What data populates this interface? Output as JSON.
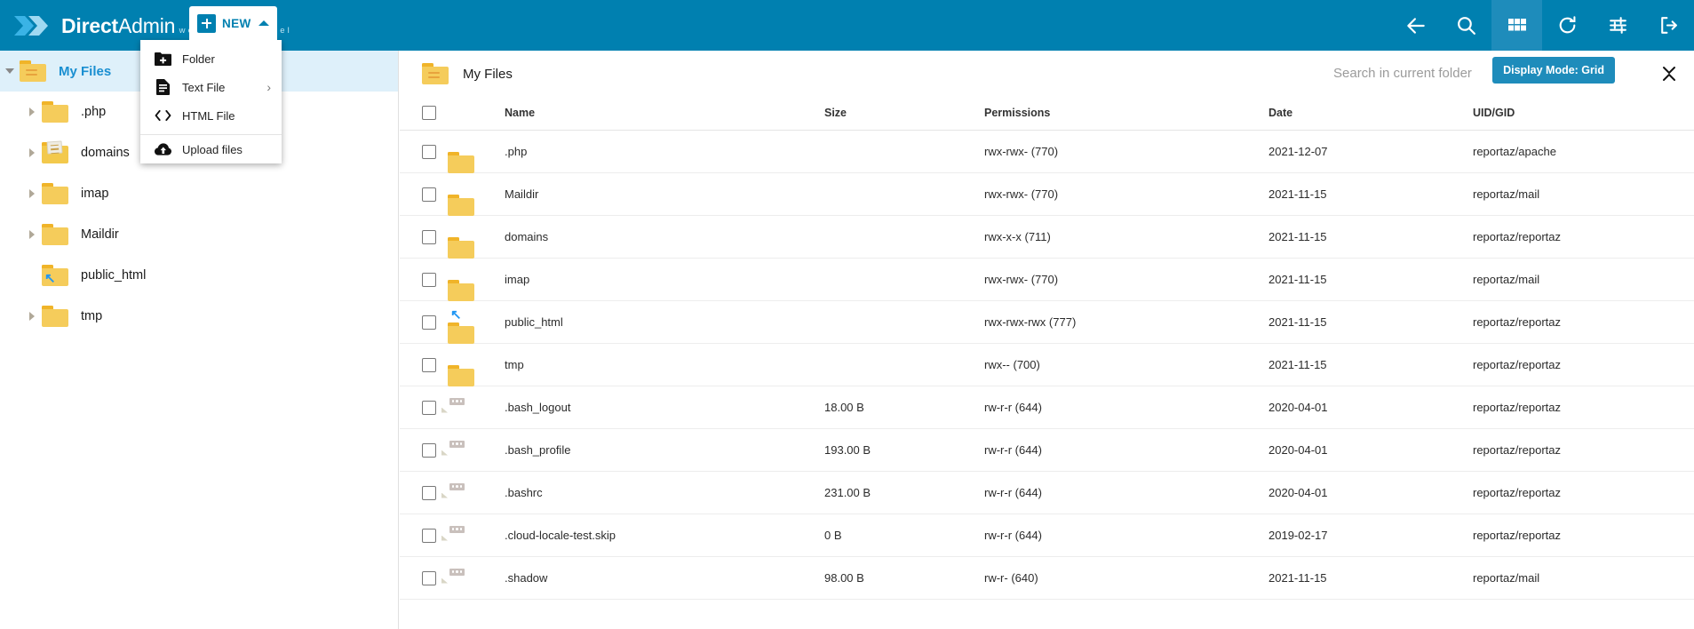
{
  "brand": {
    "title_bold": "Direct",
    "title_thin": "Admin",
    "subtitle": "web control panel",
    "accent": "#0080b0",
    "accent_active": "#1e8cbb"
  },
  "topbar": {
    "new_button": {
      "label": "NEW",
      "icon": "plus-icon",
      "caret": "chevron-up-icon"
    },
    "dropdown": {
      "items": [
        {
          "label": "Folder",
          "icon": "folder-plus-icon",
          "has_submenu": false
        },
        {
          "label": "Text File",
          "icon": "text-file-icon",
          "has_submenu": true,
          "arrow": "›"
        },
        {
          "label": "HTML File",
          "icon": "code-brackets-icon",
          "has_submenu": false
        },
        {
          "label": "Upload files",
          "icon": "cloud-upload-icon",
          "has_submenu": false,
          "separated": true
        }
      ]
    },
    "tools": [
      {
        "name": "back-arrow-icon",
        "active": false
      },
      {
        "name": "search-icon",
        "active": false
      },
      {
        "name": "grid-view-icon",
        "active": true
      },
      {
        "name": "refresh-icon",
        "active": false
      },
      {
        "name": "settings-sliders-icon",
        "active": false
      },
      {
        "name": "logout-icon",
        "active": false
      }
    ]
  },
  "sidebar": {
    "tree": [
      {
        "label": "My Files",
        "icon": "folder-lines-icon",
        "expanded": true,
        "selected": true,
        "level": 0
      },
      {
        "label": ".php",
        "icon": "folder-icon",
        "expanded": false,
        "selected": false,
        "level": 1
      },
      {
        "label": "domains",
        "icon": "folder-open-docs-icon",
        "expanded": false,
        "selected": false,
        "level": 1
      },
      {
        "label": "imap",
        "icon": "folder-icon",
        "expanded": false,
        "selected": false,
        "level": 1
      },
      {
        "label": "Maildir",
        "icon": "folder-icon",
        "expanded": false,
        "selected": false,
        "level": 1
      },
      {
        "label": "public_html",
        "icon": "folder-symlink-icon",
        "expanded": null,
        "selected": false,
        "level": 1
      },
      {
        "label": "tmp",
        "icon": "folder-icon",
        "expanded": false,
        "selected": false,
        "level": 1
      }
    ]
  },
  "main": {
    "breadcrumb": {
      "label": "My Files",
      "icon": "folder-lines-icon"
    },
    "search": {
      "placeholder": "Search in current folder",
      "value": ""
    },
    "tooltip": "Display Mode: Grid",
    "collapse_icon": "collapse-chevrons-icon",
    "table": {
      "columns": [
        "Name",
        "Size",
        "Permissions",
        "Date",
        "UID/GID"
      ],
      "rows": [
        {
          "icon": "folder-icon",
          "name": ".php",
          "size": "",
          "permissions": "rwx-rwx- (770)",
          "date": "2021-12-07",
          "uidgid": "reportaz/apache"
        },
        {
          "icon": "folder-icon",
          "name": "Maildir",
          "size": "",
          "permissions": "rwx-rwx- (770)",
          "date": "2021-11-15",
          "uidgid": "reportaz/mail"
        },
        {
          "icon": "folder-icon",
          "name": "domains",
          "size": "",
          "permissions": "rwx-x-x (711)",
          "date": "2021-11-15",
          "uidgid": "reportaz/reportaz"
        },
        {
          "icon": "folder-icon",
          "name": "imap",
          "size": "",
          "permissions": "rwx-rwx- (770)",
          "date": "2021-11-15",
          "uidgid": "reportaz/mail"
        },
        {
          "icon": "folder-symlink-icon",
          "name": "public_html",
          "size": "",
          "permissions": "rwx-rwx-rwx (777)",
          "date": "2021-11-15",
          "uidgid": "reportaz/reportaz"
        },
        {
          "icon": "folder-icon",
          "name": "tmp",
          "size": "",
          "permissions": "rwx-- (700)",
          "date": "2021-11-15",
          "uidgid": "reportaz/reportaz"
        },
        {
          "icon": "file-icon",
          "name": ".bash_logout",
          "size": "18.00 B",
          "permissions": "rw-r-r (644)",
          "date": "2020-04-01",
          "uidgid": "reportaz/reportaz"
        },
        {
          "icon": "file-icon",
          "name": ".bash_profile",
          "size": "193.00 B",
          "permissions": "rw-r-r (644)",
          "date": "2020-04-01",
          "uidgid": "reportaz/reportaz"
        },
        {
          "icon": "file-icon",
          "name": ".bashrc",
          "size": "231.00 B",
          "permissions": "rw-r-r (644)",
          "date": "2020-04-01",
          "uidgid": "reportaz/reportaz"
        },
        {
          "icon": "file-icon",
          "name": ".cloud-locale-test.skip",
          "size": "0 B",
          "permissions": "rw-r-r (644)",
          "date": "2019-02-17",
          "uidgid": "reportaz/reportaz"
        },
        {
          "icon": "file-icon",
          "name": ".shadow",
          "size": "98.00 B",
          "permissions": "rw-r- (640)",
          "date": "2021-11-15",
          "uidgid": "reportaz/mail"
        }
      ]
    }
  }
}
